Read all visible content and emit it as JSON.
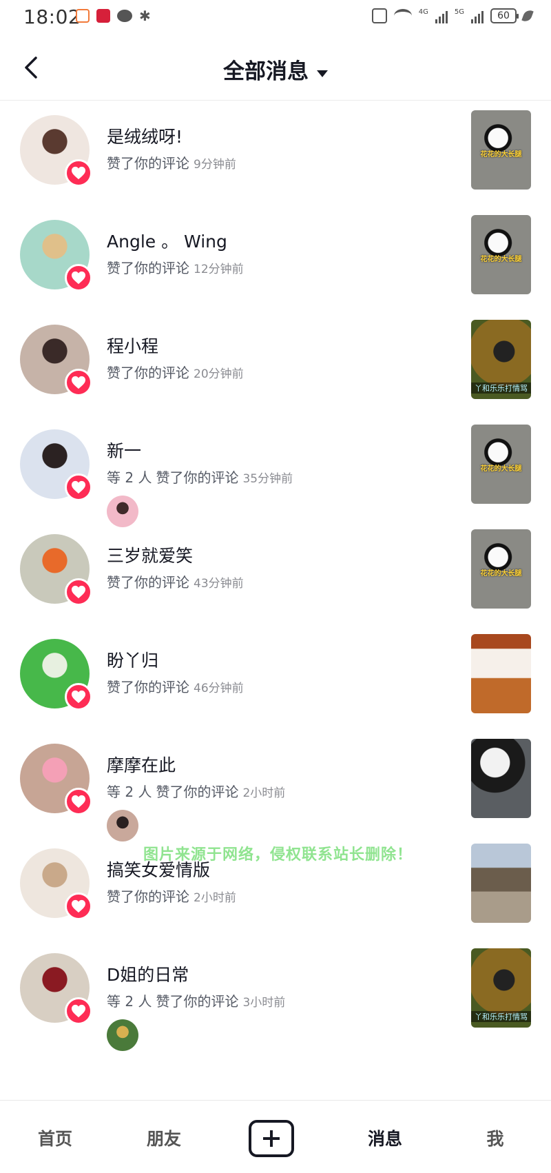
{
  "status_bar": {
    "time": "18:02",
    "network": "4G",
    "network2": "5G",
    "battery": "60"
  },
  "header": {
    "title": "全部消息"
  },
  "items": [
    {
      "name": "是绒绒呀!",
      "prefix": "",
      "action": "赞了你的评论",
      "time": "9分钟前",
      "avatar_colors": [
        "#efe6e0",
        "#5a3a30"
      ],
      "thumb": "panda",
      "thumb_caption": "花花的大长腿"
    },
    {
      "name": "Angle 。 Wing",
      "prefix": "",
      "action": "赞了你的评论",
      "time": "12分钟前",
      "avatar_colors": [
        "#a7d8c9",
        "#e0c08a"
      ],
      "thumb": "panda",
      "thumb_caption": "花花的大长腿"
    },
    {
      "name": "程小程",
      "prefix": "",
      "action": "赞了你的评论",
      "time": "20分钟前",
      "avatar_colors": [
        "#c6b3a8",
        "#3a2a28"
      ],
      "thumb": "panda-brown",
      "thumb_caption": "丫和乐乐打情骂"
    },
    {
      "name": "新一",
      "prefix": "等 2 人",
      "action": "赞了你的评论",
      "time": "35分钟前",
      "avatar_colors": [
        "#dbe2ee",
        "#2b2222"
      ],
      "thumb": "panda",
      "thumb_caption": "花花的大长腿",
      "sub_avatar_colors": [
        "#f2b9c8",
        "#402a2a"
      ]
    },
    {
      "name": "三岁就爱笑",
      "prefix": "",
      "action": "赞了你的评论",
      "time": "43分钟前",
      "avatar_colors": [
        "#c9c9bb",
        "#e86a2a"
      ],
      "thumb": "panda",
      "thumb_caption": "花花的大长腿"
    },
    {
      "name": "盼丫归",
      "prefix": "",
      "action": "赞了你的评论",
      "time": "46分钟前",
      "avatar_colors": [
        "#47b84a",
        "#e7f0e0"
      ],
      "thumb": "panda-red",
      "thumb_caption": ""
    },
    {
      "name": "摩摩在此",
      "prefix": "等 2 人",
      "action": "赞了你的评论",
      "time": "2小时前",
      "avatar_colors": [
        "#c7a595",
        "#f4a0b6"
      ],
      "thumb": "panda-dark",
      "thumb_caption": "",
      "sub_avatar_colors": [
        "#c9a89b",
        "#2a2020"
      ]
    },
    {
      "name": "搞笑女爱情版",
      "prefix": "",
      "action": "赞了你的评论",
      "time": "2小时前",
      "avatar_colors": [
        "#eee6de",
        "#c9a98a"
      ],
      "thumb": "park",
      "thumb_caption": ""
    },
    {
      "name": "D姐的日常",
      "prefix": "等 2 人",
      "action": "赞了你的评论",
      "time": "3小时前",
      "avatar_colors": [
        "#d8cfc3",
        "#8a1a22"
      ],
      "thumb": "panda-brown",
      "thumb_caption": "丫和乐乐打情骂",
      "sub_avatar_colors": [
        "#4a7a3a",
        "#d8b050"
      ]
    }
  ],
  "watermark": "图片来源于网络，侵权联系站长删除！",
  "nav": {
    "home": "首页",
    "friends": "朋友",
    "messages": "消息",
    "me": "我"
  },
  "colors": {
    "accent": "#fe2c55",
    "text": "#161823",
    "subtext": "#555a65"
  }
}
